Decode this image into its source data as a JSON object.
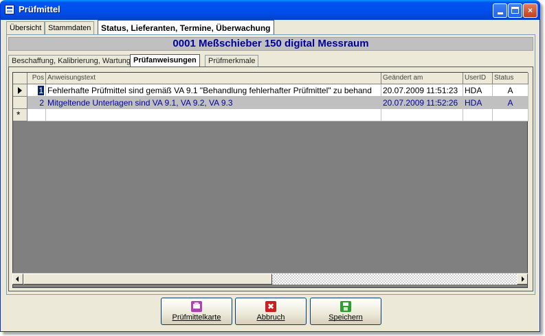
{
  "window": {
    "title": "Prüfmittel",
    "controls": {
      "minimize": "minimize",
      "maximize": "maximize",
      "close": "×"
    }
  },
  "main_tabs": [
    {
      "label": "Übersicht"
    },
    {
      "label": "Stammdaten"
    },
    {
      "label": "Status, Lieferanten, Termine, Überwachung"
    }
  ],
  "header": {
    "title": "0001 Meßschieber 150 digital Messraum"
  },
  "sub_tabs": [
    {
      "label": "Beschaffung, Kalibrierung, Wartung"
    },
    {
      "label": "Prüfanweisungen"
    },
    {
      "label": "Prüfmerkmale"
    }
  ],
  "grid": {
    "columns": [
      "Pos",
      "Anweisungstext",
      "Geändert am",
      "UserID",
      "Status"
    ],
    "rows": [
      {
        "pos": "1",
        "text": "Fehlerhafte Prüfmittel sind gemäß VA 9.1 \"Behandlung fehlerhafter Prüfmittel\" zu behand",
        "changed": "20.07.2009 11:51:23",
        "user": "HDA",
        "status": "A"
      },
      {
        "pos": "2",
        "text": "Mitgeltende Unterlagen sind VA 9.1, VA 9.2, VA 9.3",
        "changed": "20.07.2009 11:52:26",
        "user": "HDA",
        "status": "A"
      }
    ],
    "new_row_marker": "*"
  },
  "buttons": {
    "print": "Prüfmittelkarte",
    "cancel": "Abbruch",
    "save": "Speichern",
    "cancel_icon_glyph": "✖"
  },
  "colors": {
    "titlebar": "#0050ee",
    "header_text": "#0000a0",
    "row2_text": "#0000a0",
    "print_icon": "#b23fb3",
    "cancel_icon": "#c8201e",
    "save_icon": "#2f9e2f"
  }
}
